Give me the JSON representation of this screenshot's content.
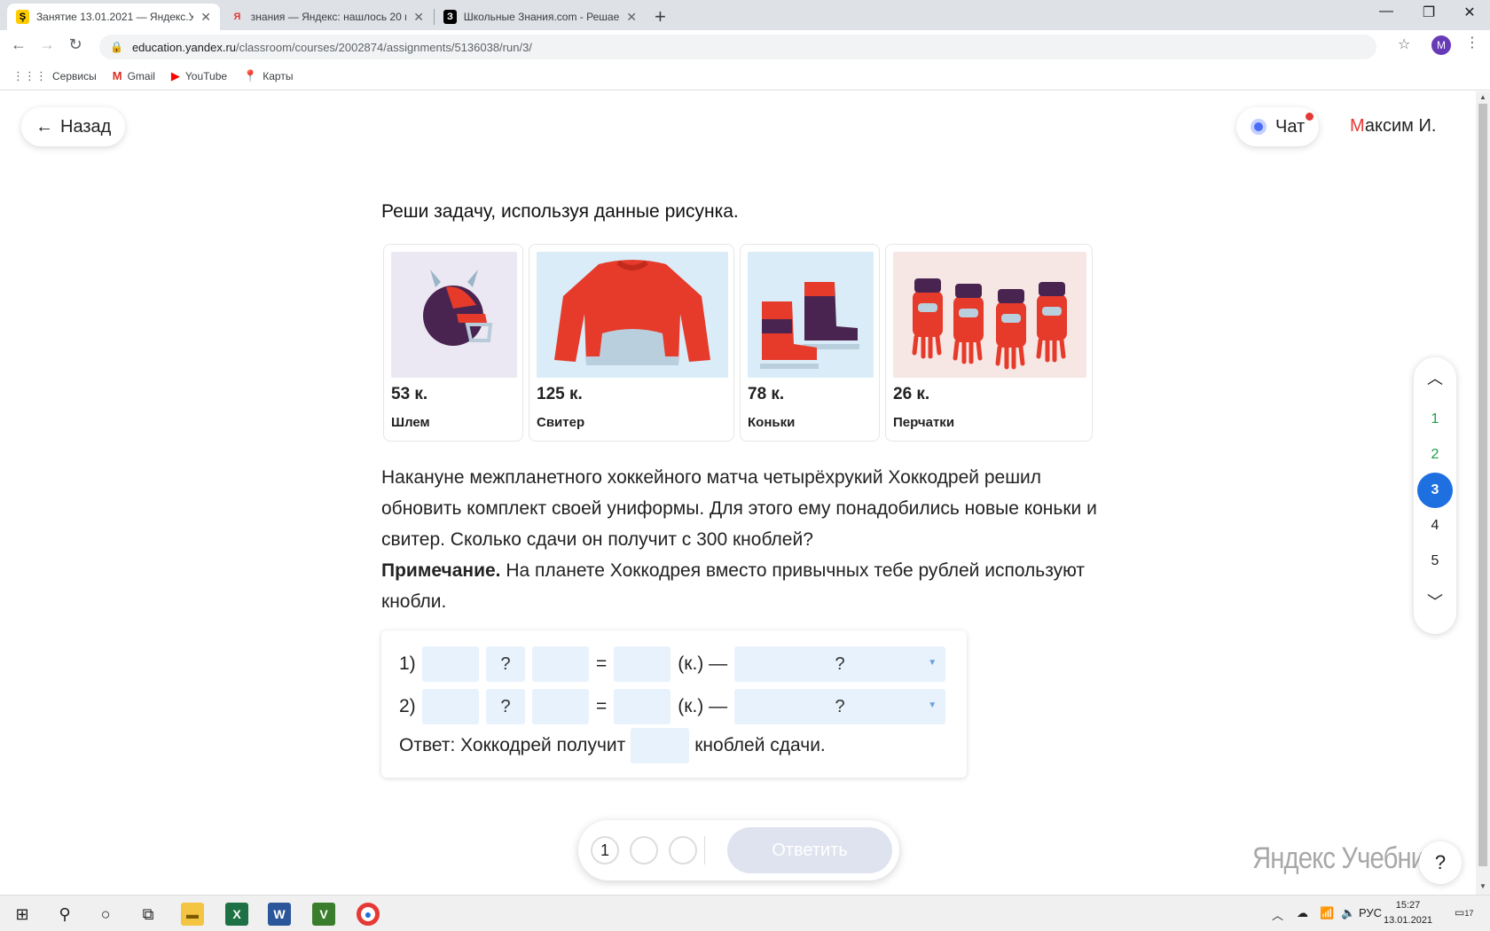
{
  "browser": {
    "tabs": [
      {
        "title": "Занятие 13.01.2021 — Яндекс.Уч",
        "favicon": "yandex-uchebnik-icon",
        "active": true
      },
      {
        "title": "знания — Яндекс: нашлось 20 м",
        "favicon": "yandex-icon",
        "active": false
      },
      {
        "title": "Школьные Знания.com - Решае",
        "favicon": "znanija-icon",
        "active": false
      }
    ],
    "new_tab_label": "+",
    "url_host": "education.yandex.ru",
    "url_path": "/classroom/courses/2002874/assignments/5136038/run/3/",
    "profile_initial": "M",
    "bookmarks": [
      {
        "label": "Сервисы",
        "icon": "apps-grid-icon"
      },
      {
        "label": "Gmail",
        "icon": "gmail-icon"
      },
      {
        "label": "YouTube",
        "icon": "youtube-icon"
      },
      {
        "label": "Карты",
        "icon": "maps-icon"
      }
    ]
  },
  "header": {
    "back_label": "Назад",
    "chat_label": "Чат",
    "user_first_letter": "М",
    "user_rest": "аксим И."
  },
  "task": {
    "title": "Реши задачу, используя данные рисунка.",
    "items": [
      {
        "price": "53 к.",
        "name": "Шлем",
        "image": "helmet-image"
      },
      {
        "price": "125 к.",
        "name": "Свитер",
        "image": "sweater-image"
      },
      {
        "price": "78 к.",
        "name": "Коньки",
        "image": "skates-image"
      },
      {
        "price": "26 к.",
        "name": "Перчатки",
        "image": "gloves-image"
      }
    ],
    "text": "Накануне межпланетного хоккейного матча четырёхрукий Хоккодрей решил обновить комплект своей униформы. Для этого ему понадобились новые коньки и свитер. Сколько сдачи он получит с 300 кноблей?",
    "note_label": "Примечание.",
    "note_text": " На планете Хоккодрея вместо привычных тебе рублей используют кнобли."
  },
  "answer": {
    "row1_num": "1)",
    "row2_num": "2)",
    "operator_placeholder": "?",
    "equals": "=",
    "unit": "(к.) —",
    "select_placeholder": "?",
    "answer_prefix": "Ответ: Хоккодрей получит",
    "answer_suffix": "кноблей сдачи."
  },
  "pager": {
    "current_attempt": "1",
    "submit_label": "Ответить"
  },
  "side_nav": {
    "items": [
      "1",
      "2",
      "3",
      "4",
      "5"
    ],
    "active": "3"
  },
  "brand": "Яндекс Учебник",
  "help_label": "?",
  "taskbar": {
    "lang": "РУС",
    "time": "15:27",
    "date": "13.01.2021",
    "notifications": "17"
  },
  "colors": {
    "accent": "#1e6fe0",
    "done": "#1e9e4a",
    "input_bg": "#e8f2fc",
    "user_letter": "#e53935"
  }
}
